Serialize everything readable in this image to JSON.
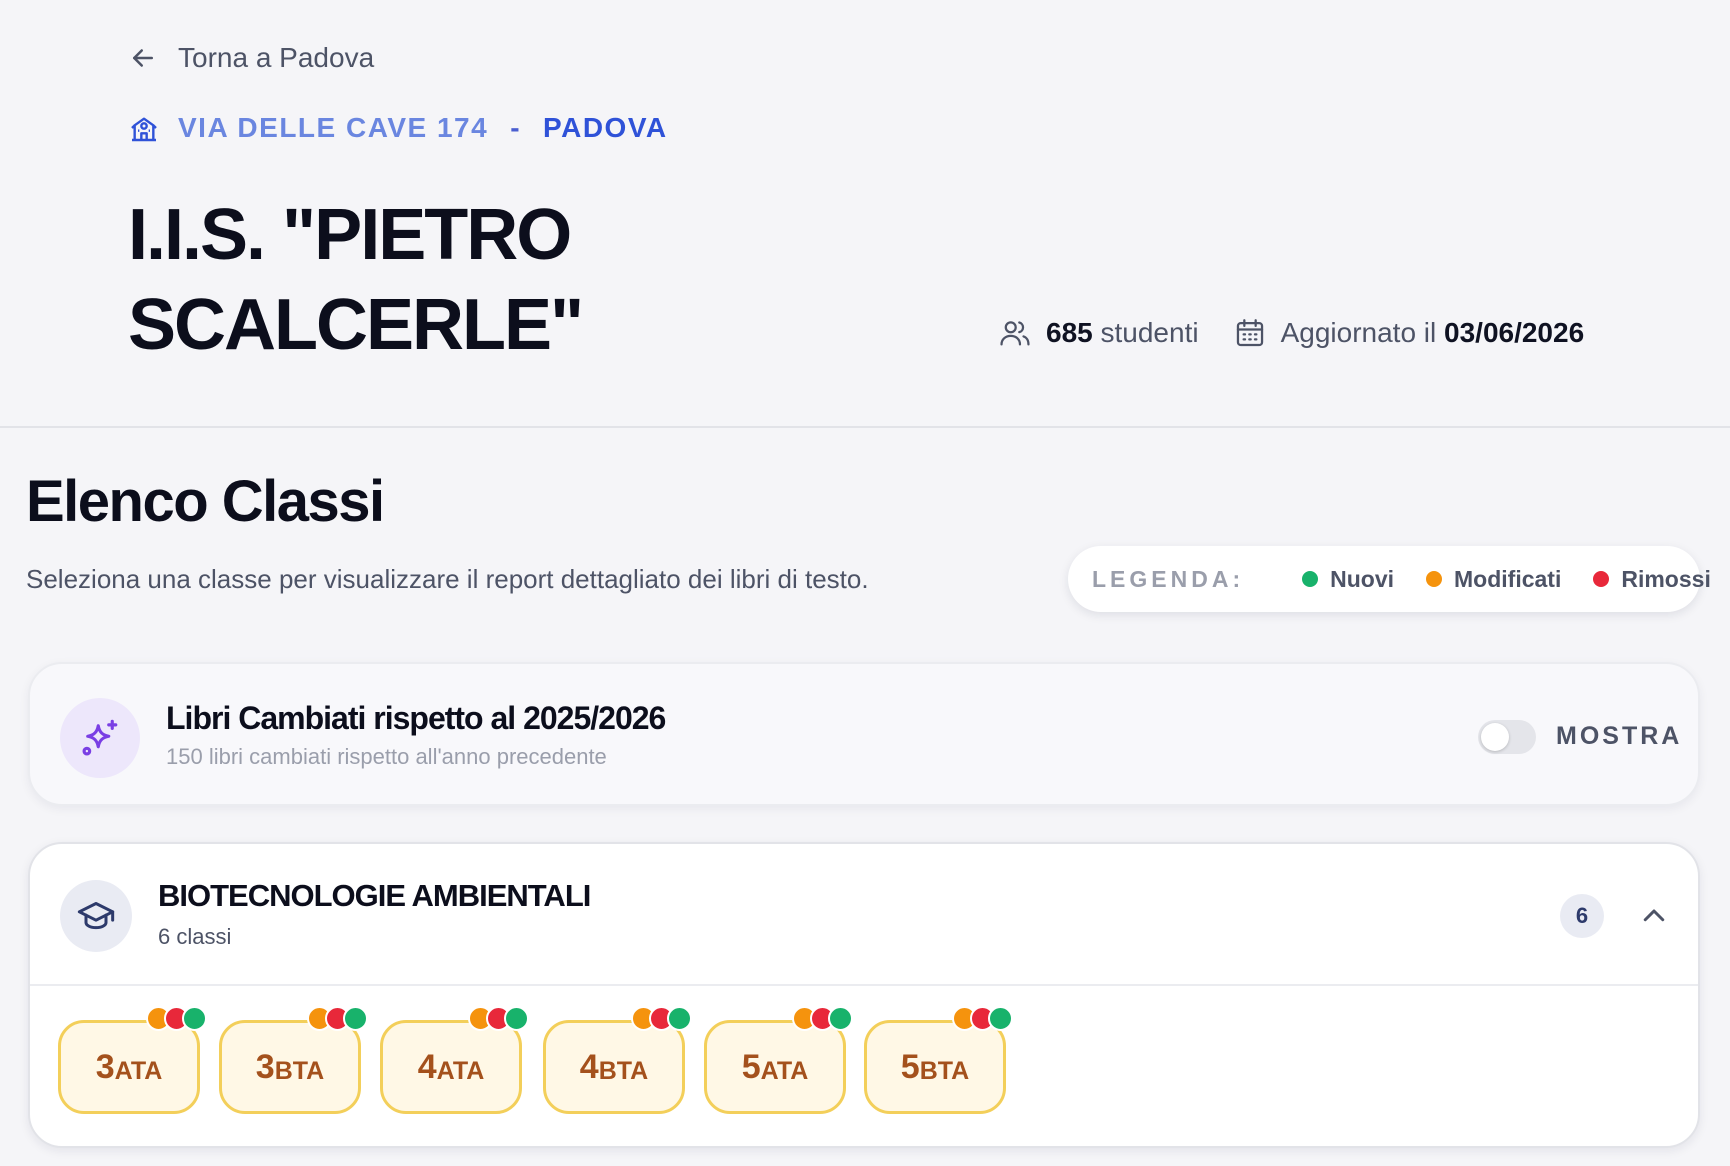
{
  "header": {
    "back_label": "Torna a Padova",
    "address_street": "VIA DELLE CAVE 174",
    "address_separator": "-",
    "address_city": "PADOVA",
    "school_name": "I.I.S. \"PIETRO SCALCERLE\"",
    "students_count": "685",
    "students_label": "studenti",
    "updated_label": "Aggiornato il",
    "updated_date": "03/06/2026"
  },
  "section": {
    "title": "Elenco Classi",
    "subtitle": "Seleziona una classe per visualizzare il report dettagliato dei libri di testo."
  },
  "legend": {
    "label": "LEGENDA:",
    "items": [
      {
        "label": "Nuovi",
        "color": "#18b26b"
      },
      {
        "label": "Modificati",
        "color": "#f5930d"
      },
      {
        "label": "Rimossi",
        "color": "#e8283a"
      }
    ]
  },
  "changed_books": {
    "title": "Libri Cambiati rispetto al 2025/2026",
    "subtitle": "150 libri cambiati rispetto all'anno precedente",
    "toggle_label": "MOSTRA",
    "toggle_on": false
  },
  "group": {
    "title": "BIOTECNOLOGIE AMBIENTALI",
    "count_text": "6 classi",
    "count": "6",
    "expanded": true,
    "classes": [
      {
        "grade": "3",
        "section": "ATA"
      },
      {
        "grade": "3",
        "section": "BTA"
      },
      {
        "grade": "4",
        "section": "ATA"
      },
      {
        "grade": "4",
        "section": "BTA"
      },
      {
        "grade": "5",
        "section": "ATA"
      },
      {
        "grade": "5",
        "section": "BTA"
      }
    ]
  },
  "colors": {
    "accent_blue": "#2f52d8",
    "chip_border": "#f3cf5a",
    "chip_bg": "#fff8e6",
    "chip_text": "#a4511c",
    "status_new": "#18b26b",
    "status_modified": "#f5930d",
    "status_removed": "#e8283a"
  }
}
